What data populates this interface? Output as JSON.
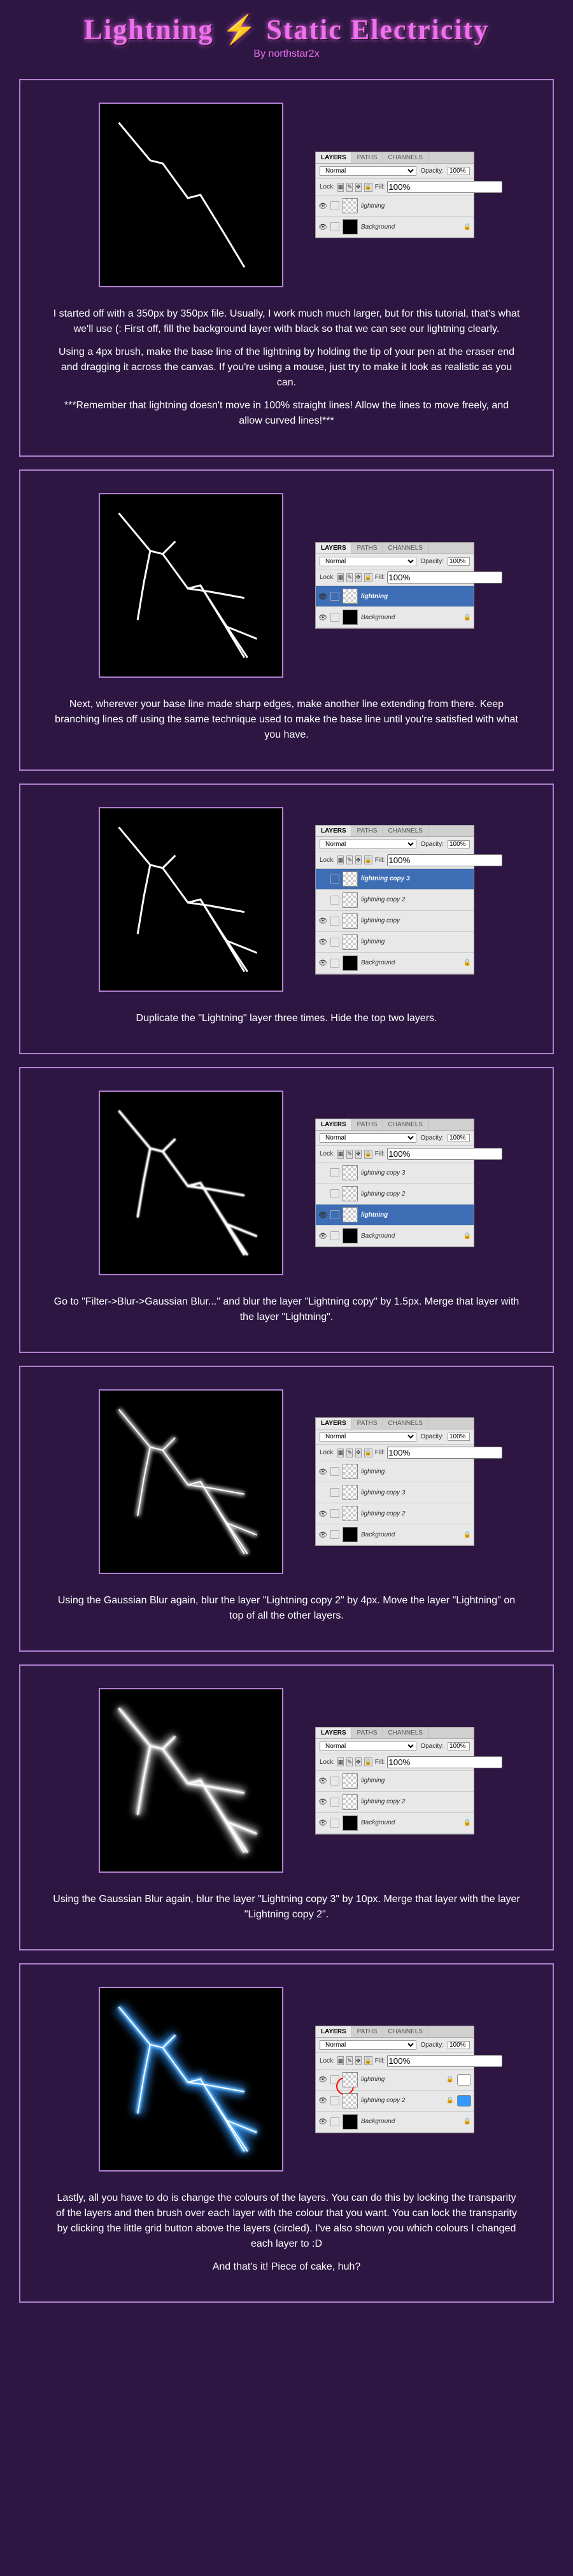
{
  "title_a": "Lightning",
  "title_b": "Static Electricity",
  "byline": "By northstar2x",
  "panel": {
    "tabs": [
      "LAYERS",
      "PATHS",
      "CHANNELS"
    ],
    "mode": "Normal",
    "opacity_label": "Opacity:",
    "opacity_value": "100%",
    "lock_label": "Lock:",
    "fill_label": "Fill:",
    "fill_value": "100%"
  },
  "steps": [
    {
      "layers": [
        {
          "name": "lightning",
          "visible": true,
          "selected": false,
          "thumb": "checker"
        },
        {
          "name": "Background",
          "visible": true,
          "selected": false,
          "thumb": "black",
          "locked": true
        }
      ],
      "text": [
        "I started off with a 350px by 350px file. Usually, I work much much larger, but for this tutorial, that's what we'll use (: First off, fill the background layer with black so that we can see our lightning clearly.",
        "Using a 4px brush, make the base line of the lightning by holding the tip of your pen at the eraser end and dragging it across the canvas. If you're using a mouse, just try to make it look as realistic as you can.",
        "***Remember that lightning doesn't move in 100% straight lines! Allow the lines to move freely, and allow curved lines!***"
      ]
    },
    {
      "layers": [
        {
          "name": "lightning",
          "visible": true,
          "selected": true,
          "thumb": "checker"
        },
        {
          "name": "Background",
          "visible": true,
          "selected": false,
          "thumb": "black",
          "locked": true
        }
      ],
      "text": [
        "Next, wherever your base line made sharp edges, make another line extending from there. Keep branching lines off using the same technique used to make the base line until you're satisfied with what you have."
      ]
    },
    {
      "layers": [
        {
          "name": "lightning copy 3",
          "visible": false,
          "selected": true,
          "thumb": "checker"
        },
        {
          "name": "lightning copy 2",
          "visible": false,
          "selected": false,
          "thumb": "checker"
        },
        {
          "name": "lightning copy",
          "visible": true,
          "selected": false,
          "thumb": "checker"
        },
        {
          "name": "lightning",
          "visible": true,
          "selected": false,
          "thumb": "checker"
        },
        {
          "name": "Background",
          "visible": true,
          "selected": false,
          "thumb": "black",
          "locked": true
        }
      ],
      "text": [
        "Duplicate the \"Lightning\" layer three times. Hide the top two layers."
      ]
    },
    {
      "layers": [
        {
          "name": "lightning copy 3",
          "visible": false,
          "selected": false,
          "thumb": "checker"
        },
        {
          "name": "lightning copy 2",
          "visible": false,
          "selected": false,
          "thumb": "checker"
        },
        {
          "name": "lightning",
          "visible": true,
          "selected": true,
          "thumb": "checker"
        },
        {
          "name": "Background",
          "visible": true,
          "selected": false,
          "thumb": "black",
          "locked": true
        }
      ],
      "text": [
        "Go to \"Filter->Blur->Gaussian Blur...\" and blur the layer \"Lightning copy\" by 1.5px. Merge that layer with the layer \"Lightning\"."
      ]
    },
    {
      "layers": [
        {
          "name": "lightning",
          "visible": true,
          "selected": false,
          "thumb": "checker"
        },
        {
          "name": "lightning copy 3",
          "visible": false,
          "selected": false,
          "thumb": "checker"
        },
        {
          "name": "lightning copy 2",
          "visible": true,
          "selected": false,
          "thumb": "checker"
        },
        {
          "name": "Background",
          "visible": true,
          "selected": false,
          "thumb": "black",
          "locked": true
        }
      ],
      "text": [
        "Using the Gaussian Blur again, blur the layer \"Lightning copy 2\" by 4px. Move the layer \"Lightning\" on top of all the other layers."
      ]
    },
    {
      "layers": [
        {
          "name": "lightning",
          "visible": true,
          "selected": false,
          "thumb": "checker"
        },
        {
          "name": "lightning copy 2",
          "visible": true,
          "selected": false,
          "thumb": "checker"
        },
        {
          "name": "Background",
          "visible": true,
          "selected": false,
          "thumb": "black",
          "locked": true
        }
      ],
      "text": [
        "Using the Gaussian Blur again, blur the layer \"Lightning copy 3\" by 10px. Merge that layer with the layer \"Lightning copy 2\"."
      ]
    },
    {
      "layers": [
        {
          "name": "lightning",
          "visible": true,
          "selected": false,
          "thumb": "checker",
          "locked": true,
          "swatch": "#ffffff"
        },
        {
          "name": "lightning copy 2",
          "visible": true,
          "selected": false,
          "thumb": "checker",
          "locked": true,
          "swatch": "#3399ff"
        },
        {
          "name": "Background",
          "visible": true,
          "selected": false,
          "thumb": "black",
          "locked": true
        }
      ],
      "circle": true,
      "text": [
        "Lastly, all you have to do is change the colours of the layers. You can do this by locking the transparity of the layers and then brush over each layer with the colour that you want. You can lock the transparity by clicking the little grid button above the layers (circled). I've also shown you which colours I changed each layer to :D",
        "And that's it! Piece of cake, huh?"
      ]
    }
  ]
}
